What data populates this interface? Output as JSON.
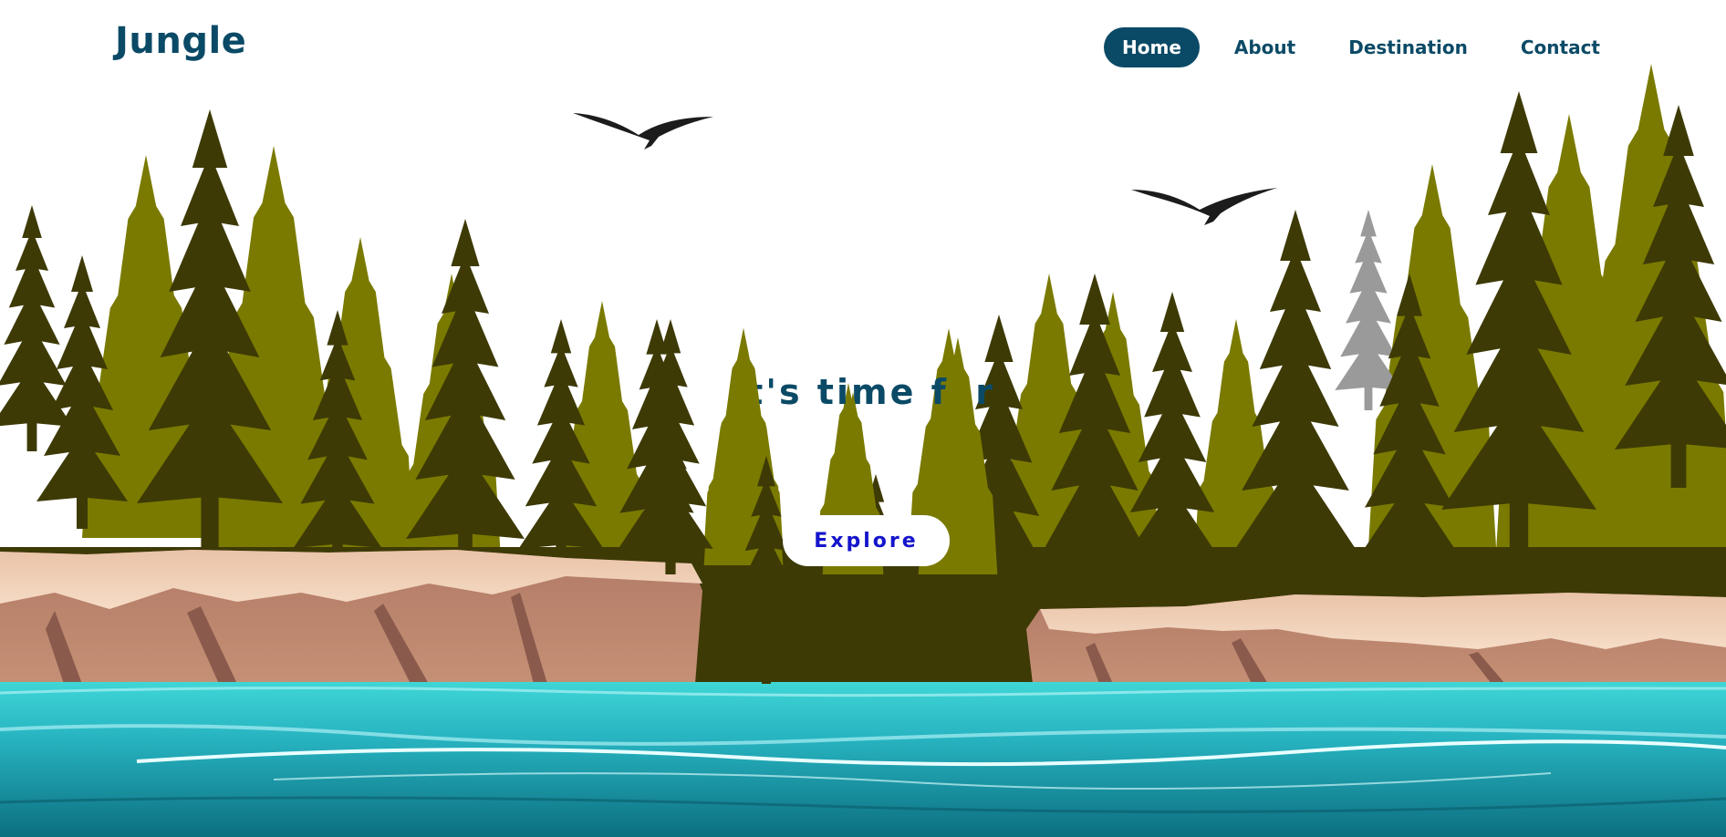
{
  "brand": {
    "name": "Jungle"
  },
  "nav": {
    "items": [
      {
        "label": "Home",
        "active": true
      },
      {
        "label": "About",
        "active": false
      },
      {
        "label": "Destination",
        "active": false
      },
      {
        "label": "Contact",
        "active": false
      }
    ]
  },
  "hero": {
    "title": "It's time for",
    "cta_label": "Explore"
  },
  "colors": {
    "brand": "#0b4a66",
    "nav_active_bg": "#0b4a66",
    "cta_text": "#1414cc",
    "tree_olive": "#7a7a00",
    "tree_dark": "#3d3a06",
    "cliff": "#b9826a",
    "water": "#1b97a8"
  },
  "scene": {
    "icons": [
      "bird-icon",
      "bird-icon",
      "pine-tree-icon",
      "cliff-icon",
      "water-icon"
    ]
  }
}
